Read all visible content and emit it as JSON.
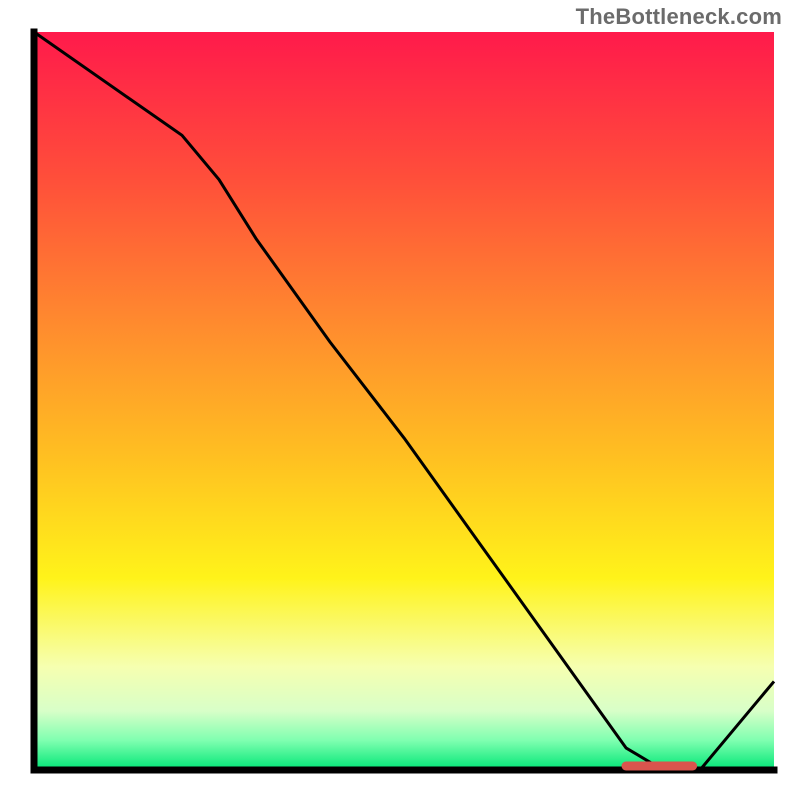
{
  "watermark": "TheBottleneck.com",
  "chart_data": {
    "type": "line",
    "title": "",
    "xlabel": "",
    "ylabel": "",
    "xlim": [
      0,
      100
    ],
    "ylim": [
      0,
      100
    ],
    "grid": false,
    "legend": false,
    "series": [
      {
        "name": "curve",
        "x": [
          0,
          10,
          20,
          25,
          30,
          40,
          50,
          60,
          70,
          80,
          85,
          90,
          95,
          100
        ],
        "y": [
          100,
          93,
          86,
          80,
          72,
          58,
          45,
          31,
          17,
          3,
          0,
          0,
          6,
          12
        ]
      }
    ],
    "highlight_segment": {
      "x_start": 80,
      "x_end": 89,
      "y": 0
    },
    "green_band_y": [
      0,
      3
    ],
    "gradient_stops": [
      {
        "offset": 0.0,
        "color": "#ff1a4b"
      },
      {
        "offset": 0.2,
        "color": "#ff4f3a"
      },
      {
        "offset": 0.4,
        "color": "#ff8c2e"
      },
      {
        "offset": 0.58,
        "color": "#ffc121"
      },
      {
        "offset": 0.74,
        "color": "#fff31a"
      },
      {
        "offset": 0.86,
        "color": "#f6ffb0"
      },
      {
        "offset": 0.92,
        "color": "#d8ffc8"
      },
      {
        "offset": 0.96,
        "color": "#7fffb0"
      },
      {
        "offset": 1.0,
        "color": "#00e676"
      }
    ],
    "colors": {
      "axis": "#000000",
      "curve": "#000000",
      "highlight": "#d9544d"
    }
  }
}
